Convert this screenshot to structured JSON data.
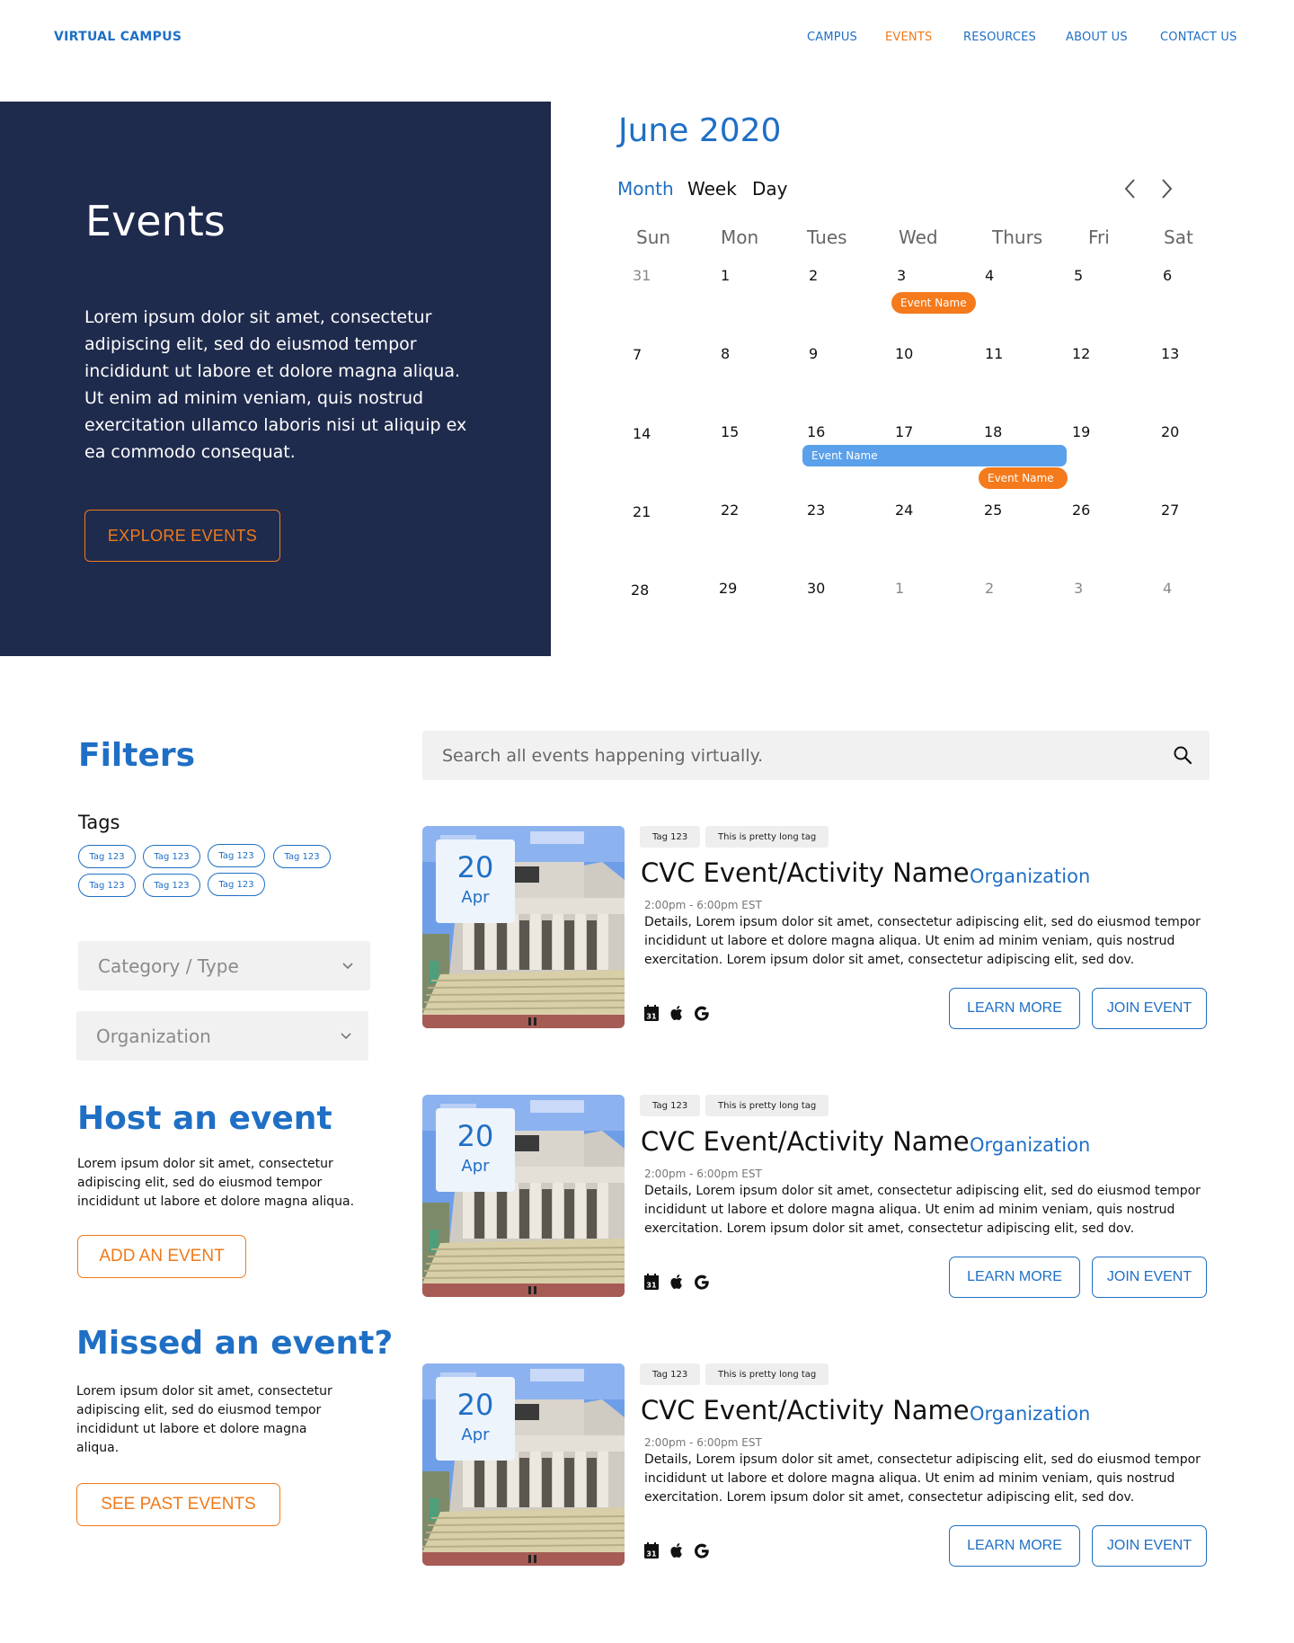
{
  "header": {
    "brand": "VIRTUAL CAMPUS",
    "nav": [
      "CAMPUS",
      "EVENTS",
      "RESOURCES",
      "ABOUT US",
      "CONTACT US"
    ],
    "active_nav": "EVENTS"
  },
  "hero": {
    "title": "Events",
    "text": "Lorem ipsum dolor sit amet, consectetur adipiscing elit, sed do eiusmod tempor incididunt ut labore et dolore magna aliqua. Ut enim ad minim veniam, quis nostrud exercitation ullamco laboris nisi ut aliquip ex ea commodo consequat.",
    "button": "EXPLORE EVENTS"
  },
  "calendar": {
    "title": "June 2020",
    "views": [
      "Month",
      "Week",
      "Day"
    ],
    "active_view": "Month",
    "weekdays": [
      "Sun",
      "Mon",
      "Tues",
      "Wed",
      "Thurs",
      "Fri",
      "Sat"
    ],
    "weeks": [
      [
        "31",
        "1",
        "2",
        "3",
        "4",
        "5",
        "6"
      ],
      [
        "7",
        "8",
        "9",
        "10",
        "11",
        "12",
        "13"
      ],
      [
        "14",
        "15",
        "16",
        "17",
        "18",
        "19",
        "20"
      ],
      [
        "21",
        "22",
        "23",
        "24",
        "25",
        "26",
        "27"
      ],
      [
        "28",
        "29",
        "30",
        "1",
        "2",
        "3",
        "4"
      ]
    ],
    "events": [
      {
        "label": "Event Name",
        "color": "orange"
      },
      {
        "label": "Event Name",
        "color": "blue"
      },
      {
        "label": "Event Name",
        "color": "orange"
      }
    ],
    "colors": {
      "orange": "#f47a1c",
      "blue": "#5aa0ea"
    }
  },
  "sidebar": {
    "filters_title": "Filters",
    "tags_label": "Tags",
    "tags": [
      "Tag 123",
      "Tag 123",
      "Tag 123",
      "Tag 123",
      "Tag 123",
      "Tag 123",
      "Tag 123"
    ],
    "category_placeholder": "Category / Type",
    "organization_placeholder": "Organization",
    "host_title": "Host an event",
    "host_text": "Lorem ipsum dolor sit amet, consectetur adipiscing elit, sed do eiusmod tempor incididunt ut labore et dolore magna aliqua.",
    "host_button": "ADD AN EVENT",
    "missed_title": "Missed an event?",
    "missed_text": "Lorem ipsum dolor sit amet, consectetur adipiscing elit, sed do eiusmod tempor incididunt ut labore et dolore magna aliqua.",
    "missed_button": "SEE PAST EVENTS"
  },
  "search": {
    "placeholder": "Search all events happening virtually."
  },
  "events": [
    {
      "day": "20",
      "month": "Apr",
      "tags": [
        "Tag 123",
        "This is pretty long tag"
      ],
      "title": "CVC Event/Activity Name",
      "organization": "Organization",
      "time": "2:00pm - 6:00pm EST",
      "details": "Details, Lorem ipsum dolor sit amet, consectetur adipiscing elit, sed do eiusmod tempor incididunt ut labore et dolore magna aliqua. Ut enim ad minim veniam, quis nostrud exercitation. Lorem ipsum dolor sit amet, consectetur adipiscing elit, sed dov.",
      "learn_more": "LEARN MORE",
      "join": "JOIN EVENT",
      "calendar_icons": [
        "calendar-31-icon",
        "apple-icon",
        "google-icon"
      ]
    },
    {
      "day": "20",
      "month": "Apr",
      "tags": [
        "Tag 123",
        "This is pretty long tag"
      ],
      "title": "CVC Event/Activity Name",
      "organization": "Organization",
      "time": "2:00pm - 6:00pm EST",
      "details": "Details, Lorem ipsum dolor sit amet, consectetur adipiscing elit, sed do eiusmod tempor incididunt ut labore et dolore magna aliqua. Ut enim ad minim veniam, quis nostrud exercitation. Lorem ipsum dolor sit amet, consectetur adipiscing elit, sed dov.",
      "learn_more": "LEARN MORE",
      "join": "JOIN EVENT",
      "calendar_icons": [
        "calendar-31-icon",
        "apple-icon",
        "google-icon"
      ]
    },
    {
      "day": "20",
      "month": "Apr",
      "tags": [
        "Tag 123",
        "This is pretty long tag"
      ],
      "title": "CVC Event/Activity Name",
      "organization": "Organization",
      "time": "2:00pm - 6:00pm EST",
      "details": "Details, Lorem ipsum dolor sit amet, consectetur adipiscing elit, sed do eiusmod tempor incididunt ut labore et dolore magna aliqua. Ut enim ad minim veniam, quis nostrud exercitation. Lorem ipsum dolor sit amet, consectetur adipiscing elit, sed dov.",
      "learn_more": "LEARN MORE",
      "join": "JOIN EVENT",
      "calendar_icons": [
        "calendar-31-icon",
        "apple-icon",
        "google-icon"
      ]
    }
  ]
}
